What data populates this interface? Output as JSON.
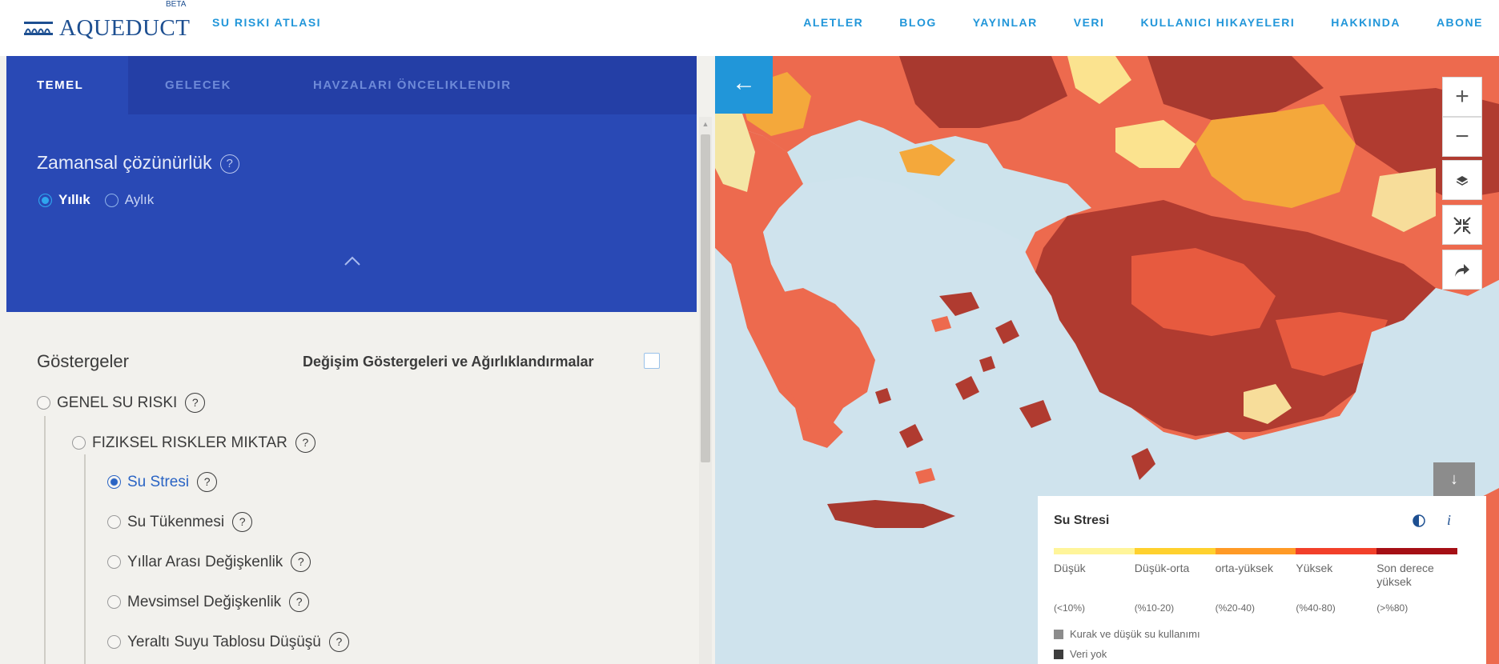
{
  "header": {
    "logo_text": "AQUEDUCT",
    "beta": "BETA",
    "app_name": "SU RISKI ATLASI",
    "nav": [
      "ALETLER",
      "BLOG",
      "YAYINLAR",
      "VERI",
      "KULLANICI HIKAYELERI",
      "HAKKINDA",
      "ABONE"
    ]
  },
  "panel": {
    "tabs": [
      "TEMEL",
      "GELECEK",
      "HAVZALARI ÖNCELIKLENDIR"
    ],
    "temporal": {
      "title": "Zamansal çözünürlük",
      "help": "?",
      "options": [
        "Yıllık",
        "Aylık"
      ],
      "selected": "Yıllık"
    },
    "indicators": {
      "title": "Göstergeler",
      "change_label": "Değişim Göstergeleri ve Ağırlıklandırmalar",
      "change_checked": false,
      "items": [
        {
          "label": "GENEL SU RISKI",
          "help": "?"
        },
        {
          "label": "FIZIKSEL RISKLER MIKTAR",
          "help": "?"
        },
        {
          "label": "Su Stresi",
          "help": "?",
          "selected": true
        },
        {
          "label": "Su Tükenmesi",
          "help": "?"
        },
        {
          "label": "Yıllar Arası Değişkenlik",
          "help": "?"
        },
        {
          "label": "Mevsimsel Değişkenlik",
          "help": "?"
        },
        {
          "label": "Yeraltı Suyu Tablosu Düşüşü",
          "help": "?"
        }
      ]
    }
  },
  "map": {
    "zoom_in": "+",
    "zoom_out": "−",
    "legend": {
      "title": "Su Stresi",
      "icons": [
        "contrast-icon",
        "info-icon"
      ],
      "info_glyph": "i",
      "colors": [
        "#fff59a",
        "#ffd12e",
        "#ff9a26",
        "#f2402a",
        "#a50f15"
      ],
      "categories": [
        {
          "label": "Düşük",
          "range": "(<10%)"
        },
        {
          "label": "Düşük-orta",
          "range": "(%10-20)"
        },
        {
          "label": "orta-yüksek",
          "range": "(%20-40)"
        },
        {
          "label": "Yüksek",
          "range": "(%40-80)"
        },
        {
          "label": "Son derece yüksek",
          "range": "(>%80)"
        }
      ],
      "extras": [
        {
          "label": "Kurak ve düşük su kullanımı",
          "color": "#8c8c8c"
        },
        {
          "label": "Veri yok",
          "color": "#3d3d3d"
        }
      ]
    }
  }
}
